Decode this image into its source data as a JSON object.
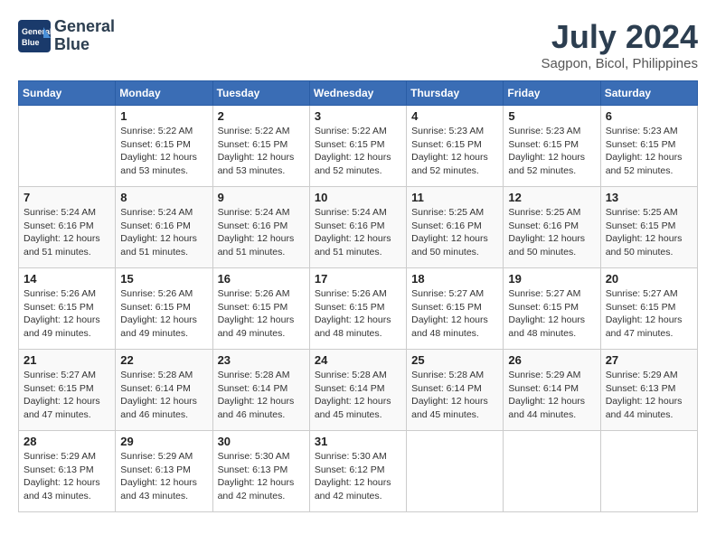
{
  "header": {
    "logo_line1": "General",
    "logo_line2": "Blue",
    "month_year": "July 2024",
    "location": "Sagpon, Bicol, Philippines"
  },
  "days_of_week": [
    "Sunday",
    "Monday",
    "Tuesday",
    "Wednesday",
    "Thursday",
    "Friday",
    "Saturday"
  ],
  "weeks": [
    [
      {
        "day": "",
        "info": ""
      },
      {
        "day": "1",
        "info": "Sunrise: 5:22 AM\nSunset: 6:15 PM\nDaylight: 12 hours\nand 53 minutes."
      },
      {
        "day": "2",
        "info": "Sunrise: 5:22 AM\nSunset: 6:15 PM\nDaylight: 12 hours\nand 53 minutes."
      },
      {
        "day": "3",
        "info": "Sunrise: 5:22 AM\nSunset: 6:15 PM\nDaylight: 12 hours\nand 52 minutes."
      },
      {
        "day": "4",
        "info": "Sunrise: 5:23 AM\nSunset: 6:15 PM\nDaylight: 12 hours\nand 52 minutes."
      },
      {
        "day": "5",
        "info": "Sunrise: 5:23 AM\nSunset: 6:15 PM\nDaylight: 12 hours\nand 52 minutes."
      },
      {
        "day": "6",
        "info": "Sunrise: 5:23 AM\nSunset: 6:15 PM\nDaylight: 12 hours\nand 52 minutes."
      }
    ],
    [
      {
        "day": "7",
        "info": "Sunrise: 5:24 AM\nSunset: 6:16 PM\nDaylight: 12 hours\nand 51 minutes."
      },
      {
        "day": "8",
        "info": "Sunrise: 5:24 AM\nSunset: 6:16 PM\nDaylight: 12 hours\nand 51 minutes."
      },
      {
        "day": "9",
        "info": "Sunrise: 5:24 AM\nSunset: 6:16 PM\nDaylight: 12 hours\nand 51 minutes."
      },
      {
        "day": "10",
        "info": "Sunrise: 5:24 AM\nSunset: 6:16 PM\nDaylight: 12 hours\nand 51 minutes."
      },
      {
        "day": "11",
        "info": "Sunrise: 5:25 AM\nSunset: 6:16 PM\nDaylight: 12 hours\nand 50 minutes."
      },
      {
        "day": "12",
        "info": "Sunrise: 5:25 AM\nSunset: 6:16 PM\nDaylight: 12 hours\nand 50 minutes."
      },
      {
        "day": "13",
        "info": "Sunrise: 5:25 AM\nSunset: 6:15 PM\nDaylight: 12 hours\nand 50 minutes."
      }
    ],
    [
      {
        "day": "14",
        "info": "Sunrise: 5:26 AM\nSunset: 6:15 PM\nDaylight: 12 hours\nand 49 minutes."
      },
      {
        "day": "15",
        "info": "Sunrise: 5:26 AM\nSunset: 6:15 PM\nDaylight: 12 hours\nand 49 minutes."
      },
      {
        "day": "16",
        "info": "Sunrise: 5:26 AM\nSunset: 6:15 PM\nDaylight: 12 hours\nand 49 minutes."
      },
      {
        "day": "17",
        "info": "Sunrise: 5:26 AM\nSunset: 6:15 PM\nDaylight: 12 hours\nand 48 minutes."
      },
      {
        "day": "18",
        "info": "Sunrise: 5:27 AM\nSunset: 6:15 PM\nDaylight: 12 hours\nand 48 minutes."
      },
      {
        "day": "19",
        "info": "Sunrise: 5:27 AM\nSunset: 6:15 PM\nDaylight: 12 hours\nand 48 minutes."
      },
      {
        "day": "20",
        "info": "Sunrise: 5:27 AM\nSunset: 6:15 PM\nDaylight: 12 hours\nand 47 minutes."
      }
    ],
    [
      {
        "day": "21",
        "info": "Sunrise: 5:27 AM\nSunset: 6:15 PM\nDaylight: 12 hours\nand 47 minutes."
      },
      {
        "day": "22",
        "info": "Sunrise: 5:28 AM\nSunset: 6:14 PM\nDaylight: 12 hours\nand 46 minutes."
      },
      {
        "day": "23",
        "info": "Sunrise: 5:28 AM\nSunset: 6:14 PM\nDaylight: 12 hours\nand 46 minutes."
      },
      {
        "day": "24",
        "info": "Sunrise: 5:28 AM\nSunset: 6:14 PM\nDaylight: 12 hours\nand 45 minutes."
      },
      {
        "day": "25",
        "info": "Sunrise: 5:28 AM\nSunset: 6:14 PM\nDaylight: 12 hours\nand 45 minutes."
      },
      {
        "day": "26",
        "info": "Sunrise: 5:29 AM\nSunset: 6:14 PM\nDaylight: 12 hours\nand 44 minutes."
      },
      {
        "day": "27",
        "info": "Sunrise: 5:29 AM\nSunset: 6:13 PM\nDaylight: 12 hours\nand 44 minutes."
      }
    ],
    [
      {
        "day": "28",
        "info": "Sunrise: 5:29 AM\nSunset: 6:13 PM\nDaylight: 12 hours\nand 43 minutes."
      },
      {
        "day": "29",
        "info": "Sunrise: 5:29 AM\nSunset: 6:13 PM\nDaylight: 12 hours\nand 43 minutes."
      },
      {
        "day": "30",
        "info": "Sunrise: 5:30 AM\nSunset: 6:13 PM\nDaylight: 12 hours\nand 42 minutes."
      },
      {
        "day": "31",
        "info": "Sunrise: 5:30 AM\nSunset: 6:12 PM\nDaylight: 12 hours\nand 42 minutes."
      },
      {
        "day": "",
        "info": ""
      },
      {
        "day": "",
        "info": ""
      },
      {
        "day": "",
        "info": ""
      }
    ]
  ]
}
